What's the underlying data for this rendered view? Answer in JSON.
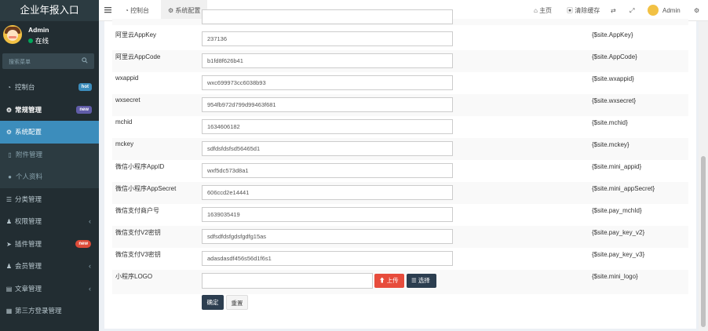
{
  "app": {
    "logo_text": "企业年报入口"
  },
  "user": {
    "name": "Admin",
    "status": "在线"
  },
  "sidebar": {
    "search_placeholder": "搜索菜单",
    "items": [
      {
        "label": "控制台",
        "icon": "dashboard-icon",
        "badge": "hot"
      },
      {
        "label": "常规管理",
        "icon": "cogs-icon",
        "badge": "new"
      },
      {
        "label": "系统配置",
        "icon": "gear-icon"
      },
      {
        "label": "附件管理",
        "icon": "file-icon"
      },
      {
        "label": "个人资料",
        "icon": "user-icon"
      },
      {
        "label": "分类管理",
        "icon": "list-icon"
      },
      {
        "label": "权限管理",
        "icon": "group-icon"
      },
      {
        "label": "插件管理",
        "icon": "rocket-icon",
        "badge": "new"
      },
      {
        "label": "会员管理",
        "icon": "users-icon"
      },
      {
        "label": "文章管理",
        "icon": "article-icon"
      },
      {
        "label": "第三方登录管理",
        "icon": "login-icon"
      }
    ]
  },
  "topbar": {
    "tabs": [
      {
        "label": "控制台",
        "icon": "dashboard-icon"
      },
      {
        "label": "系统配置",
        "icon": "gear-icon"
      }
    ],
    "home_label": "主页",
    "clear_cache_label": "清除缓存",
    "user_label": "Admin"
  },
  "form": {
    "rows": [
      {
        "label": "阿里云AppKey",
        "value": "237136",
        "var": "{$site.AppKey}"
      },
      {
        "label": "阿里云AppCode",
        "value": "b1fd8f626b41",
        "var": "{$site.AppCode}"
      },
      {
        "label": "wxappid",
        "value": "wxc699973cc6038b93",
        "var": "{$site.wxappid}"
      },
      {
        "label": "wxsecret",
        "value": "954fb972d799d99463f681",
        "var": "{$site.wxsecret}"
      },
      {
        "label": "mchid",
        "value": "1634606182",
        "var": "{$site.mchid}"
      },
      {
        "label": "mckey",
        "value": "sdfdsfdsfsd56465d1",
        "var": "{$site.mckey}"
      },
      {
        "label": "微信小程序AppID",
        "value": "wxf5dc573d8a1",
        "var": "{$site.mini_appid}"
      },
      {
        "label": "微信小程序AppSecret",
        "value": "606ccd2e14441",
        "var": "{$site.mini_appSecret}"
      },
      {
        "label": "微信支付商户号",
        "value": "1639035419",
        "var": "{$site.pay_mchId}"
      },
      {
        "label": "微信支付V2密钥",
        "value": "sdfsdfdsfgdsfgdfg15as",
        "var": "{$site.pay_key_v2}"
      },
      {
        "label": "微信支付V3密钥",
        "value": "adasdasdf456s56d1f6s1",
        "var": "{$site.pay_key_v3}"
      }
    ],
    "logo_row": {
      "label": "小程序LOGO",
      "value": "",
      "var": "{$site.mini_logo}"
    },
    "upload_label": "上传",
    "select_label": "选择",
    "confirm_label": "确定",
    "reset_label": "重置"
  }
}
